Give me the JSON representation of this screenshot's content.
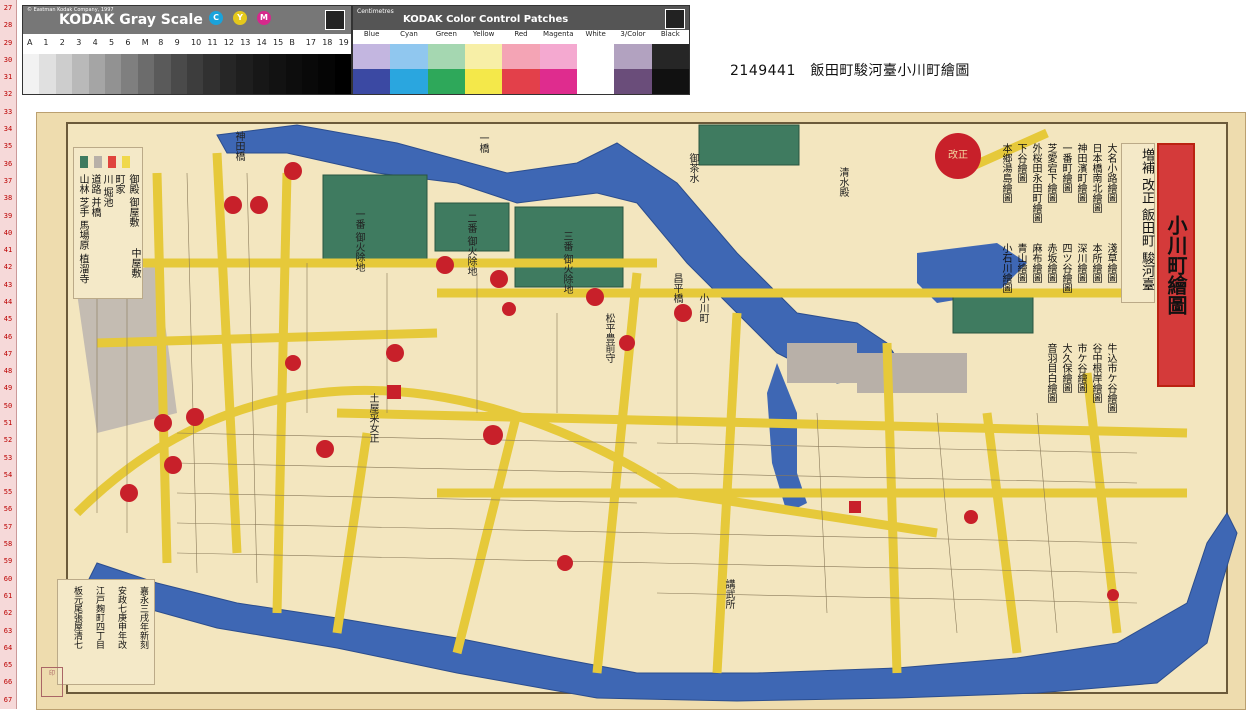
{
  "ruler": {
    "labels": [
      "27",
      "28",
      "29",
      "30",
      "31",
      "32",
      "33",
      "34",
      "35",
      "36",
      "37",
      "38",
      "39",
      "40",
      "41",
      "42",
      "43",
      "44",
      "45",
      "46",
      "47",
      "48",
      "49",
      "50",
      "51",
      "52",
      "53",
      "54",
      "55",
      "56",
      "57",
      "58",
      "59",
      "60",
      "61",
      "62",
      "63",
      "64",
      "65",
      "66",
      "67"
    ]
  },
  "gray_scale": {
    "title": "KODAK Gray Scale",
    "copyright": "© Eastman Kodak Company, 1997",
    "cym": [
      "C",
      "Y",
      "M"
    ],
    "steps_labels": [
      "A",
      "1",
      "2",
      "3",
      "4",
      "5",
      "6",
      "M",
      "8",
      "9",
      "10",
      "11",
      "12",
      "13",
      "14",
      "15",
      "B",
      "17",
      "18",
      "19"
    ],
    "colors": [
      "#f2f2f2",
      "#e0e0e0",
      "#cdcdcd",
      "#b9b9b9",
      "#a5a5a5",
      "#929292",
      "#7f7f7f",
      "#6c6c6c",
      "#5a5a5a",
      "#4a4a4a",
      "#3d3d3d",
      "#313131",
      "#262626",
      "#1e1e1e",
      "#171717",
      "#121212",
      "#0d0d0d",
      "#090909",
      "#050505",
      "#000000"
    ]
  },
  "color_card": {
    "title": "KODAK Color Control Patches",
    "unit": "Centimetres",
    "labels": [
      "Blue",
      "Cyan",
      "Green",
      "Yellow",
      "Red",
      "Magenta",
      "White",
      "3/Color",
      "Black"
    ],
    "top_colors": [
      "#3b49a3",
      "#2aa6df",
      "#2ea85a",
      "#f4e84a",
      "#e3404a",
      "#df2c8e",
      "#ffffff",
      "#6a4d7a",
      "#111111"
    ],
    "bottom_colors": [
      "#c3b6e0",
      "#90c7ef",
      "#a5d7b1",
      "#f7efa7",
      "#f4a4b5",
      "#f4a9d0",
      "#ffffff",
      "#b2a2c0",
      "#262626"
    ]
  },
  "caption": "2149441　飯田町駿河臺小川町繪圖",
  "map": {
    "title_main": "小川町繪圖",
    "title_sub_right": "飯田町",
    "title_sub_left": "駿河臺",
    "title_prefix": "増補 改正",
    "seal_text": "改正",
    "legend_items": [
      "御殿 御屋敷",
      "町家",
      "川 堀池",
      "道路 并橋",
      "中屋敷",
      "山林 芝手 馬場原 植溜寺"
    ],
    "legend_colors": [
      "#3f7b60",
      "#b8b0a8",
      "#e0443c",
      "#f0d84a"
    ],
    "index_columns": [
      "大名小路繪圖",
      "日本橋南北繪圖",
      "神田濱町繪圖",
      "一番町繪圖",
      "芝愛宕下繪圖",
      "外桜田永田町繪圖",
      "下谷繪圖",
      "本郷湯島繪圖",
      "淺草繪圖",
      "本所繪圖",
      "深川繪圖",
      "四ツ谷繪圖",
      "赤坂繪圖",
      "麻布繪圖",
      "青山繪圖",
      "小石川繪圖",
      "牛込市ケ谷繪圖",
      "谷中根岸繪圖",
      "市ケ谷繪圖",
      "大久保繪圖",
      "音羽目白繪圖"
    ],
    "publisher": [
      "嘉永三戌年新刻",
      "安政七庚申年改",
      "江戸麹町四丁目",
      "板元尾張屋清七"
    ],
    "stamp": "印",
    "places": [
      "一番 御火除地",
      "二番 御火除地",
      "三番 御火除地",
      "清水殿",
      "講武所",
      "御茶水",
      "昌平橋",
      "小川町",
      "土屋采女正",
      "松平豊前守",
      "神田橋",
      "一橋"
    ]
  }
}
